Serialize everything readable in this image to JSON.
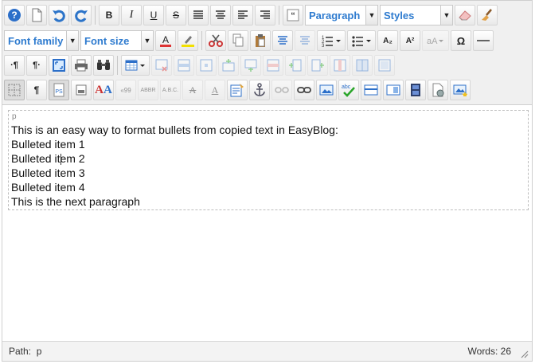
{
  "toolbar": {
    "row1": [
      "help",
      "new-document",
      "undo",
      "redo",
      "|",
      "bold",
      "italic",
      "underline",
      "strikethrough",
      "justify-full",
      "align-center",
      "align-left",
      "align-right",
      "|",
      "blockquote",
      "FORMAT",
      "STYLES",
      "eraser",
      "brush"
    ],
    "format_select": "Paragraph",
    "styles_select": "Styles",
    "font_family_select": "Font family",
    "font_size_select": "Font size",
    "labels": {
      "bold": "B",
      "italic": "I",
      "underline": "U",
      "strikethrough": "S",
      "subscript": "A₂",
      "superscript": "A²",
      "omega": "Ω",
      "pilcrow": "¶",
      "ltr": "·¶",
      "rtl": "¶·",
      "text_a": "A",
      "quotes": "«99",
      "abbr": "ABBR",
      "acronym": "A.B.C.",
      "abc": "abc"
    }
  },
  "editor": {
    "block_tag": "p",
    "lines": [
      "This is an easy way to format bullets from copied text in EasyBlog:",
      "Bulleted item 1",
      "Bulleted item 2",
      "Bulleted item 3",
      "Bulleted item 4",
      "This is the next paragraph"
    ]
  },
  "status": {
    "path_label": "Path:",
    "path_value": "p",
    "word_count": "Words: 26"
  },
  "colors": {
    "accent": "#2e7bcf",
    "toolbar_bg": "#f0f0f0"
  }
}
